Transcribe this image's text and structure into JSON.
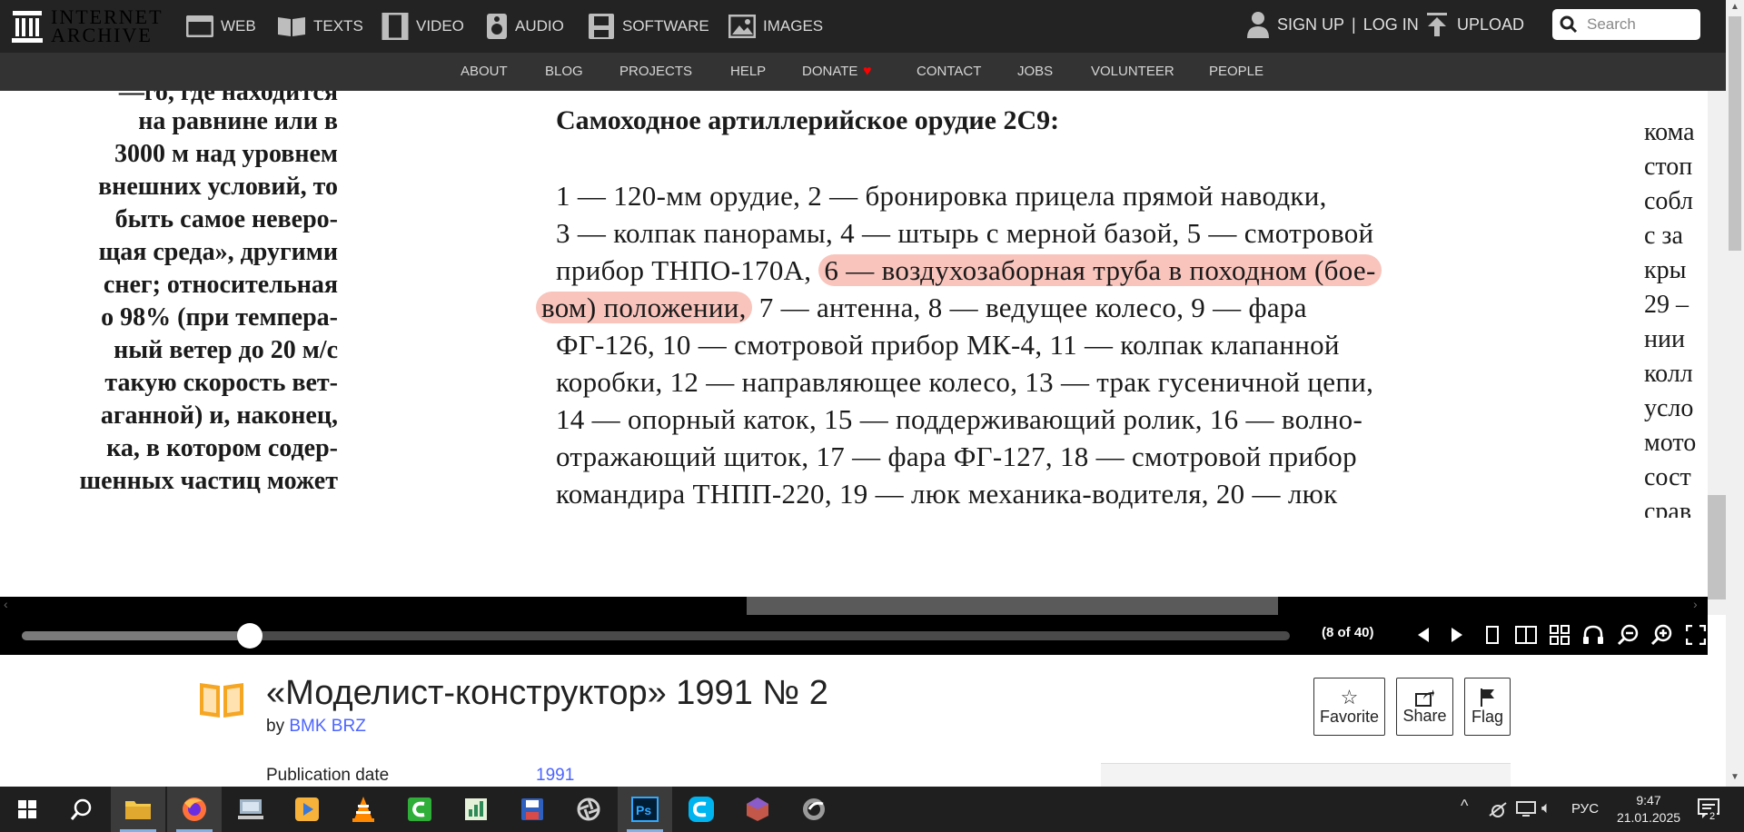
{
  "site": {
    "logo_line1": "INTERNET",
    "logo_line2": "ARCHIVE",
    "media_nav": [
      {
        "label": "WEB",
        "icon": "web-icon"
      },
      {
        "label": "TEXTS",
        "icon": "texts-icon"
      },
      {
        "label": "VIDEO",
        "icon": "video-icon"
      },
      {
        "label": "AUDIO",
        "icon": "audio-icon"
      },
      {
        "label": "SOFTWARE",
        "icon": "software-icon"
      },
      {
        "label": "IMAGES",
        "icon": "images-icon"
      }
    ],
    "signup": "SIGN UP",
    "separator": "|",
    "login": "LOG IN",
    "upload": "UPLOAD",
    "search_placeholder": "Search",
    "sub_nav": [
      "ABOUT",
      "BLOG",
      "PROJECTS",
      "HELP",
      "DONATE",
      "CONTACT",
      "JOBS",
      "VOLUNTEER",
      "PEOPLE"
    ]
  },
  "book": {
    "left_page_lines": [
      "—го, где находится",
      "на равнине или в",
      "3000 м над уровнем",
      "внешних условий, то",
      "быть самое неверо-",
      "щая среда», другими",
      "снег; относительная",
      "о 98% (при темпера-",
      "ный ветер до 20 м/с",
      "такую скорость вет-",
      "аганной) и, наконец,",
      "ка, в котором содер-",
      "шенных частиц может"
    ],
    "heading": "Самоходное артиллерийское орудие 2С9:",
    "body_lines": [
      {
        "pre": "1 — 120-мм орудие, 2 — бронировка прицела прямой наводки,",
        "hl": "",
        "post": ""
      },
      {
        "pre": "3 — колпак панорамы, 4 — штырь с мерной базой, 5 — смотровой",
        "hl": "",
        "post": ""
      },
      {
        "pre": "прибор ТНПО-170А, ",
        "hl": "6 — воздухозаборная труба в походном (бое-",
        "post": ""
      },
      {
        "pre": "",
        "hl": "вом) положении,",
        "post": " 7 — антенна, 8 — ведущее колесо, 9 — фара"
      },
      {
        "pre": "ФГ-126, 10 — смотровой прибор МК-4, 11 — колпак клапанной",
        "hl": "",
        "post": ""
      },
      {
        "pre": "коробки, 12 — направляющее колесо, 13 — трак гусеничной цепи,",
        "hl": "",
        "post": ""
      },
      {
        "pre": "14 — опорный каток, 15 — поддерживающий ролик, 16 — волно-",
        "hl": "",
        "post": ""
      },
      {
        "pre": "отражающий щиток, 17 — фара ФГ-127, 18 — смотровой прибор",
        "hl": "",
        "post": ""
      },
      {
        "pre": "командира ТНПП-220, 19 — люк механика-водителя, 20 — люк",
        "hl": "",
        "post": ""
      }
    ],
    "right_page_lines": [
      "кома",
      "стоп",
      "собл",
      "с за",
      "кры",
      "29 –",
      "нии",
      "колл",
      "усло",
      "мото",
      "сост",
      "срав"
    ]
  },
  "viewer": {
    "page_indicator": "(8 of 40)",
    "progress": 0.18
  },
  "item": {
    "title": "«Моделист-конструктор» 1991 № 2",
    "by_label": "by",
    "author": "BMK BRZ",
    "favorite": "Favorite",
    "share": "Share",
    "flag": "Flag",
    "meta_label": "Publication date",
    "meta_value": "1991"
  },
  "taskbar": {
    "language": "РУС",
    "time": "9:47",
    "date": "21.01.2025",
    "notifications": "2"
  },
  "colors": {
    "topbar": "#232323",
    "subbar": "#333333",
    "highlight": "#f8c4bc",
    "link": "#4b64ff",
    "book_icon": "#f5a623",
    "heart": "#ff0000"
  }
}
